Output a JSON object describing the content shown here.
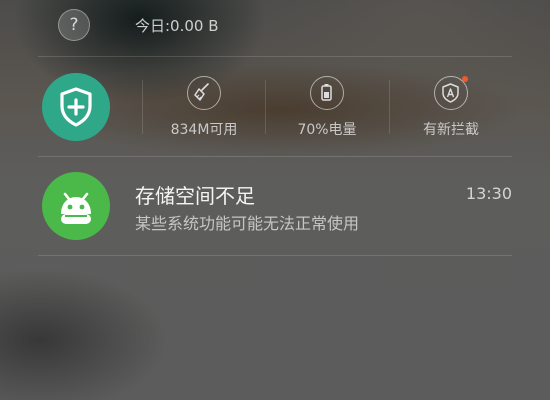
{
  "status_row": {
    "today_label": "今日:0.00 B",
    "help_icon": "question-circle-icon"
  },
  "quick_tools": {
    "shield_icon": "shield-plus-icon",
    "shield_color": "#2fa88a",
    "items": [
      {
        "label": "834M可用",
        "icon": "broom-clean-icon"
      },
      {
        "label": "70%电量",
        "icon": "battery-icon"
      },
      {
        "label": "有新拦截",
        "icon": "block-shield-icon",
        "badge_color": "#ef5b2c"
      }
    ]
  },
  "notification": {
    "icon": "android-robot-icon",
    "icon_color": "#4bb84a",
    "title": "存储空间不足",
    "time": "13:30",
    "text": "某些系统功能可能无法正常使用"
  }
}
